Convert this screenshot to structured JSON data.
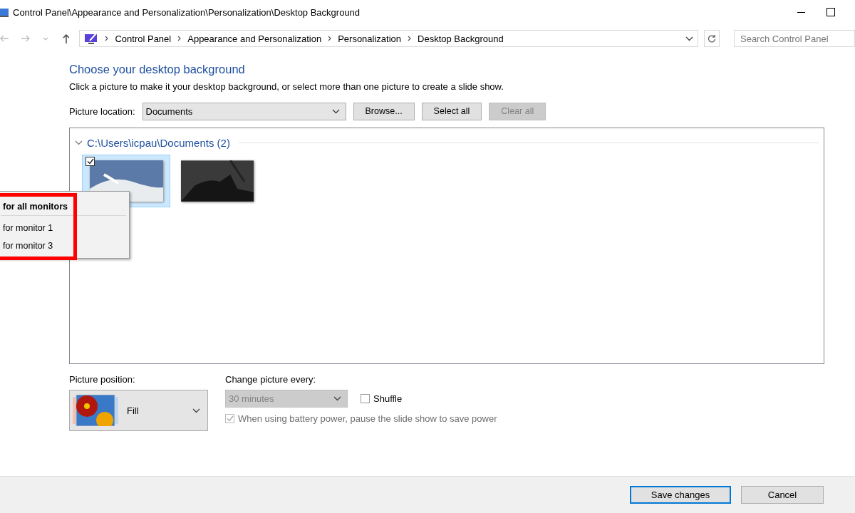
{
  "window": {
    "title": "Control Panel\\Appearance and Personalization\\Personalization\\Desktop Background"
  },
  "address_bar": {
    "breadcrumbs": [
      "Control Panel",
      "Appearance and Personalization",
      "Personalization",
      "Desktop Background"
    ]
  },
  "search": {
    "placeholder": "Search Control Panel"
  },
  "heading": "Choose your desktop background",
  "description": "Click a picture to make it your desktop background, or select more than one picture to create a slide show.",
  "picture_location": {
    "label": "Picture location:",
    "value": "Documents"
  },
  "location_buttons": [
    {
      "label": "Browse...",
      "disabled": false
    },
    {
      "label": "Select all",
      "disabled": false
    },
    {
      "label": "Clear all",
      "disabled": true
    }
  ],
  "picture_group": {
    "title": "C:\\Users\\icpau\\Documents (2)",
    "expanded": true,
    "pictures": [
      {
        "kind": "snow",
        "selected": true,
        "checked": true
      },
      {
        "kind": "dark",
        "selected": false,
        "checked": false
      }
    ]
  },
  "context_menu": {
    "items": [
      {
        "label": "for all monitors",
        "kind": "default"
      },
      {
        "label": "for monitor 1",
        "kind": "normal"
      },
      {
        "label": "for monitor 3",
        "kind": "normal"
      }
    ]
  },
  "picture_position": {
    "label": "Picture position:",
    "value": "Fill"
  },
  "change_picture": {
    "label": "Change picture every:",
    "value": "30 minutes",
    "disabled": true
  },
  "shuffle": {
    "label": "Shuffle",
    "checked": false
  },
  "battery": {
    "label": "When using battery power, pause the slide show to save power",
    "checked": true,
    "disabled": true
  },
  "footer_buttons": [
    {
      "label": "Save changes",
      "selected": true
    },
    {
      "label": "Cancel",
      "selected": false
    }
  ]
}
